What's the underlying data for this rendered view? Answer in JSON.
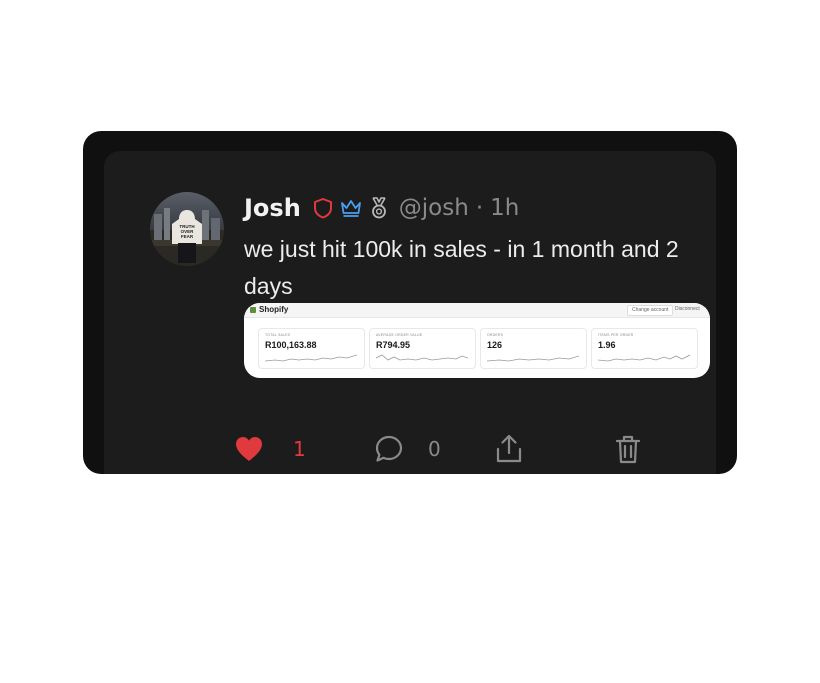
{
  "post": {
    "author_name": "Josh",
    "handle": "@josh",
    "separator": "·",
    "time_ago": "1h",
    "text": "we just hit 100k in sales - in 1 month and 2 days",
    "badges": [
      "shield-icon",
      "crown-icon",
      "medal-icon"
    ],
    "avatar_shirt_text": "TRUTH OVER FEAR"
  },
  "media": {
    "app_name": "Shopify",
    "buttons": [
      "Change account",
      "Disconnect"
    ],
    "metrics": [
      {
        "label": "TOTAL SALES",
        "value": "R100,163.88"
      },
      {
        "label": "AVERAGE ORDER VALUE",
        "value": "R794.95"
      },
      {
        "label": "ORDERS",
        "value": "126"
      },
      {
        "label": "ITEMS PER ORDER",
        "value": "1.96"
      }
    ]
  },
  "actions": {
    "like_count": "1",
    "comment_count": "0",
    "liked": true
  },
  "colors": {
    "like": "#e0393e",
    "badge_red": "#e0393e",
    "badge_blue": "#4a9eed",
    "badge_gray": "#b8b8b8",
    "icon_gray": "#8a8a8a",
    "card_bg": "#1c1c1c"
  }
}
